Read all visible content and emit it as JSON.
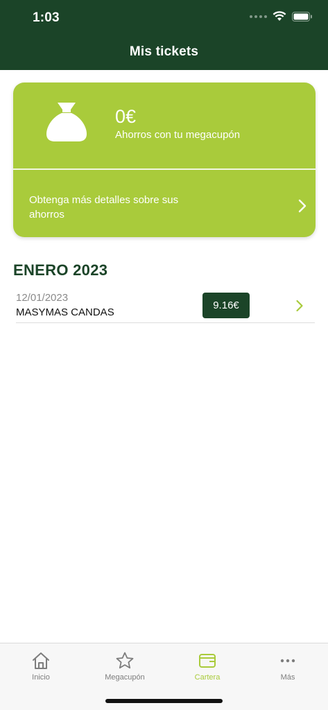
{
  "status_bar": {
    "time": "1:03"
  },
  "header": {
    "title": "Mis tickets"
  },
  "savings_card": {
    "amount": "0€",
    "subtitle": "Ahorros con tu megacupón",
    "details_text": "Obtenga más detalles sobre sus ahorros",
    "icon": "money-bag-icon"
  },
  "month": {
    "title": "ENERO 2023"
  },
  "tickets": [
    {
      "date": "12/01/2023",
      "store": "MASYMAS CANDAS",
      "amount": "9.16€"
    }
  ],
  "tabbar": {
    "active": "Cartera",
    "items": [
      {
        "label": "Inicio",
        "icon": "home-icon"
      },
      {
        "label": "Megacupón",
        "icon": "star-icon"
      },
      {
        "label": "Cartera",
        "icon": "wallet-icon"
      },
      {
        "label": "Más",
        "icon": "more-icon"
      }
    ]
  },
  "colors": {
    "header_bg": "#1b4428",
    "accent_green": "#a9cb3b",
    "badge_bg": "#1b4428",
    "tab_inactive": "#7d7d7d"
  }
}
